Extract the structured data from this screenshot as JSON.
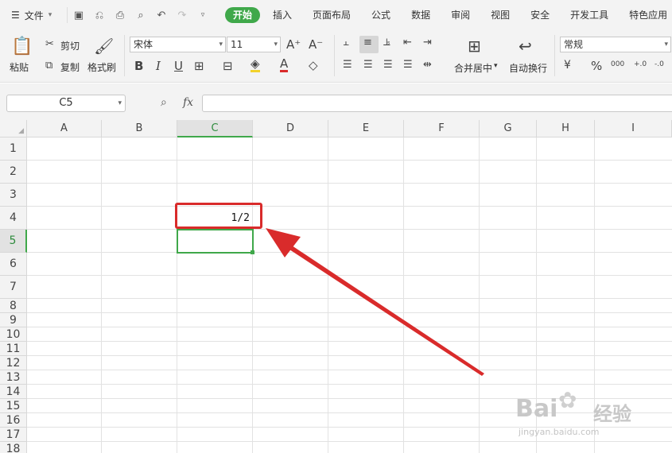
{
  "menubar": {
    "file_label": "文件",
    "tabs": [
      "开始",
      "插入",
      "页面布局",
      "公式",
      "数据",
      "审阅",
      "视图",
      "安全",
      "开发工具",
      "特色应用"
    ],
    "active_tab": "开始"
  },
  "ribbon": {
    "paste": "粘贴",
    "cut": "剪切",
    "copy": "复制",
    "format_painter": "格式刷",
    "font_name": "宋体",
    "font_size": "11",
    "merge_center": "合并居中",
    "wrap_text": "自动换行",
    "number_format": "常规",
    "bold": "B",
    "italic": "I",
    "underline": "U",
    "font_grow": "A⁺",
    "font_shrink": "A⁻",
    "percent": "%",
    "thousands": "000",
    "dec_inc": "+.0",
    "dec_dec": "-.0"
  },
  "formula_bar": {
    "name_box": "C5",
    "fx": "fx",
    "value": ""
  },
  "sheet": {
    "columns": [
      "A",
      "B",
      "C",
      "D",
      "E",
      "F",
      "G",
      "H",
      "I"
    ],
    "rows": [
      "1",
      "2",
      "3",
      "4",
      "5",
      "6",
      "7",
      "8",
      "9",
      "10",
      "11",
      "12",
      "13",
      "14",
      "15",
      "16",
      "17",
      "18"
    ],
    "selected_column": "C",
    "selected_row": "5",
    "cells": {
      "C4": "1/2"
    }
  },
  "watermark": {
    "brand": "Bai",
    "brand2": "经验",
    "url": "jingyan.baidu.com"
  },
  "colors": {
    "accent_green": "#3fa84a",
    "annotation_red": "#d92b2b"
  }
}
